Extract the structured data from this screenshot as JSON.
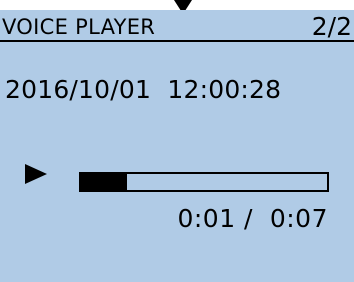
{
  "header": {
    "title": "VOICE PLAYER",
    "page": "2/2"
  },
  "recording": {
    "datetime": "2016/10/01  12:00:28"
  },
  "playback": {
    "state_icon": "play-icon",
    "progress_fraction": 0.1875,
    "time_display": "0:01 /  0:07"
  },
  "colors": {
    "lcd_background": "#b0cbe6",
    "foreground": "#000000"
  }
}
